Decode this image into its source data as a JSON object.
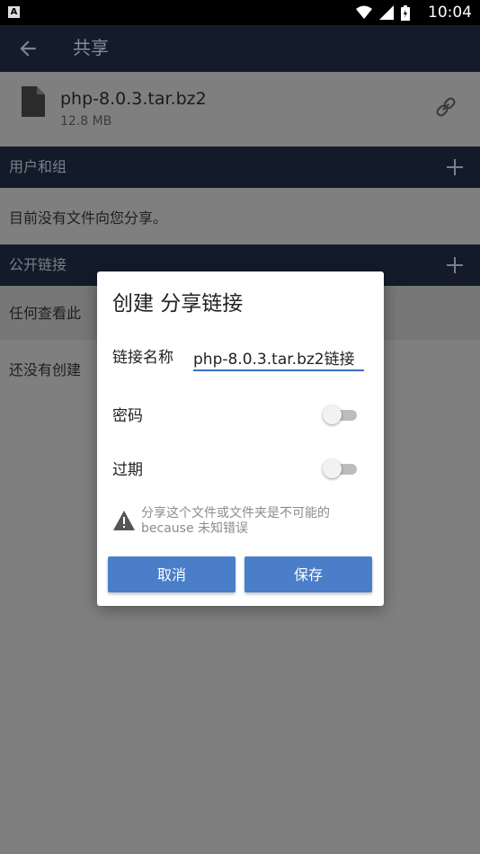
{
  "statusbar": {
    "time": "10:04",
    "notification_letter": "A"
  },
  "toolbar": {
    "title": "共享"
  },
  "file": {
    "name": "php-8.0.3.tar.bz2",
    "size": "12.8 MB"
  },
  "sections": {
    "users_groups": {
      "label": "用户和组",
      "empty_text": "目前没有文件向您分享。"
    },
    "public_links": {
      "label": "公开链接",
      "info_text": "任何查看此",
      "empty_text": "还没有创建"
    }
  },
  "dialog": {
    "title": "创建 分享链接",
    "link_name_label": "链接名称",
    "link_name_value": "php-8.0.3.tar.bz2链接",
    "password_label": "密码",
    "password_enabled": false,
    "expiry_label": "过期",
    "expiry_enabled": false,
    "warning_text": "分享这个文件或文件夹是不可能的 because 未知错误",
    "cancel_label": "取消",
    "save_label": "保存"
  },
  "colors": {
    "accent": "#4a7ec9",
    "header_bg": "#131b2a",
    "scrim_bg": "#7f7f7f"
  }
}
